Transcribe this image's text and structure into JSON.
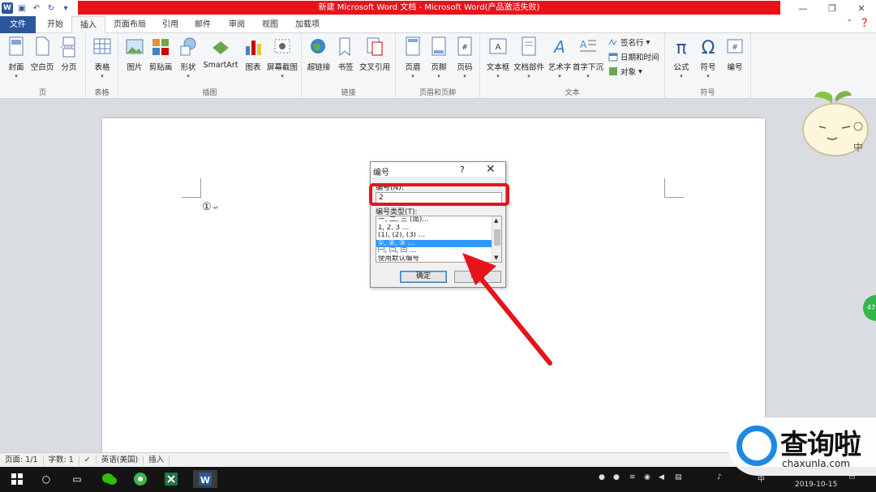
{
  "window": {
    "title": "新建 Microsoft Word 文档 - Microsoft Word(产品激活失败)",
    "app_icon": "W",
    "controls": [
      "minimize-icon",
      "restore-icon",
      "close-icon"
    ]
  },
  "tabs": [
    {
      "label": "文件"
    },
    {
      "label": "开始"
    },
    {
      "label": "插入"
    },
    {
      "label": "页面布局"
    },
    {
      "label": "引用"
    },
    {
      "label": "邮件"
    },
    {
      "label": "审阅"
    },
    {
      "label": "视图"
    },
    {
      "label": "加载项"
    }
  ],
  "ribbon": {
    "page_group": {
      "label": "页",
      "buttons": [
        "封面",
        "空白页",
        "分页"
      ]
    },
    "table_group": {
      "label": "表格",
      "buttons": [
        "表格"
      ]
    },
    "illustration_group": {
      "label": "插图",
      "buttons": [
        "图片",
        "剪贴画",
        "形状",
        "SmartArt",
        "图表",
        "屏幕截图"
      ]
    },
    "link_group": {
      "label": "链接",
      "buttons": [
        "超链接",
        "书签",
        "交叉引用"
      ]
    },
    "header_group": {
      "label": "页眉和页脚",
      "buttons": [
        "页眉",
        "页脚",
        "页码"
      ]
    },
    "text_group": {
      "label": "文本",
      "buttons": [
        "文本框",
        "文档部件",
        "艺术字",
        "首字下沉"
      ],
      "small": [
        "签名行",
        "日期和时间",
        "对象"
      ]
    },
    "symbol_group": {
      "label": "符号",
      "buttons": [
        "公式",
        "符号",
        "编号"
      ]
    }
  },
  "document": {
    "content": "①",
    "para_mark": "↵"
  },
  "dialog": {
    "title": "编号",
    "help": "?",
    "number_label": "编号(N):",
    "number_value": "2",
    "type_label": "编号类型(T):",
    "list_items": [
      "一, 二, 三 (简)…",
      "1, 2, 3 …",
      "(1), (2), (3) …",
      "①, ②, ③ …",
      "㈠, ㈡, ㈢ …",
      "使用默认编号"
    ],
    "selected_index": 3,
    "ok_label": "确定",
    "cancel_label": "取消"
  },
  "status": {
    "page": "页面: 1/1",
    "words": "字数: 1",
    "lang": "英语(美国)",
    "mode": "插入"
  },
  "taskbar": {
    "ime": "中",
    "date": "2019-10-15"
  },
  "watermark": {
    "text": "查询啦",
    "url": "chaxunla.com"
  },
  "side_badge": "47",
  "colors": {
    "accent": "#2b579a",
    "highlight_red": "#e8131a",
    "selection": "#3399ff"
  }
}
